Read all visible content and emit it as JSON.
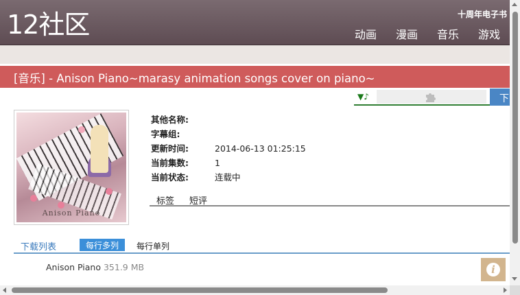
{
  "site": {
    "logo": "12社区",
    "tagline": "十周年电子书",
    "nav": [
      "动画",
      "漫画",
      "音乐",
      "游戏"
    ]
  },
  "title": "[音乐] - Anison Piano~marasy animation songs cover on piano~",
  "player": {
    "note_icon": "▼♪",
    "plugin_icon": "puzzle-icon"
  },
  "download_button": "下",
  "cover": {
    "caption": "Anison Piano"
  },
  "info": [
    {
      "key": "其他名称:",
      "value": ""
    },
    {
      "key": "字幕组:",
      "value": ""
    },
    {
      "key": "更新时间:",
      "value": "2014-06-13 01:25:15"
    },
    {
      "key": "当前集数:",
      "value": "1"
    },
    {
      "key": "当前状态:",
      "value": "连载中"
    }
  ],
  "detail_tabs": [
    "标签",
    "短评"
  ],
  "download_tabs": {
    "title": "下载列表",
    "multi": "每行多列",
    "single": "每行单列"
  },
  "files": [
    {
      "name": "Anison Piano",
      "size": "351.9 MB"
    }
  ],
  "info_button": "i",
  "colors": {
    "header": "#6b5a61",
    "title_bar": "#cf5b5b",
    "accent_blue": "#3b8fd9",
    "info_button": "#d2b58e"
  }
}
